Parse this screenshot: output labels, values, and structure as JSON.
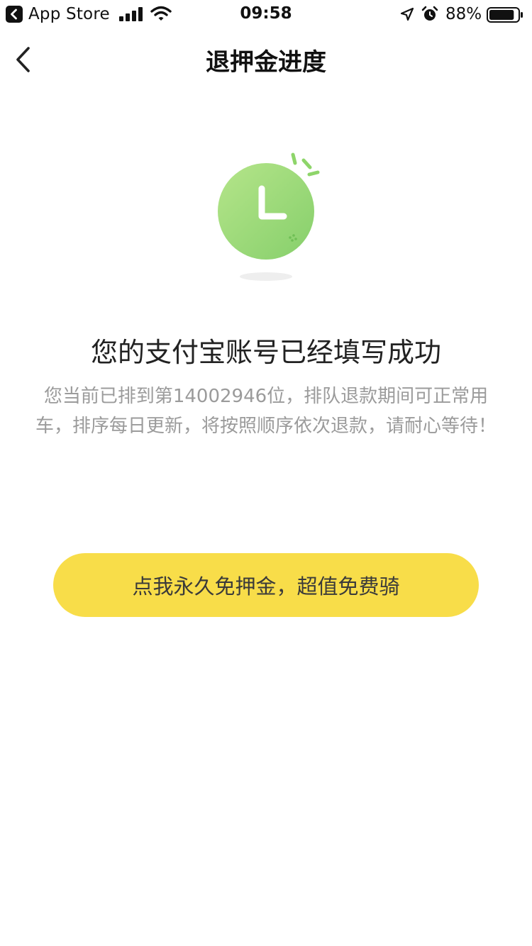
{
  "status_bar": {
    "back_app_label": "App Store",
    "time": "09:58",
    "battery_percent": "88%",
    "icons": [
      "back-to-app-icon",
      "signal-icon",
      "wifi-icon",
      "location-icon",
      "alarm-icon",
      "battery-icon"
    ],
    "battery_level": 0.88
  },
  "nav": {
    "back_icon": "chevron-left-icon",
    "title": "退押金进度"
  },
  "illustration": {
    "icon": "clock-icon",
    "colors": {
      "clock_light": "#b5e58a",
      "clock_dark": "#86cf6b",
      "accent": "#8ed56a",
      "shadow": "#eeeeee"
    }
  },
  "content": {
    "title": "您的支付宝账号已经填写成功",
    "description": "您当前已排到第14002946位，排队退款期间可正常用车，排序每日更新，将按照顺序依次退款，请耐心等待！"
  },
  "cta": {
    "label": "点我永久免押金，超值免费骑",
    "color": "#f8dd49"
  }
}
